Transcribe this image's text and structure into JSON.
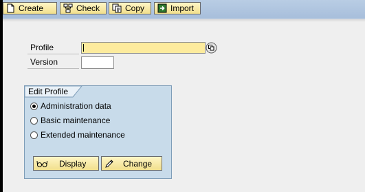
{
  "toolbar": {
    "buttons": [
      {
        "label": "Create",
        "icon": "new-document-icon"
      },
      {
        "label": "Check",
        "icon": "check-hierarchy-icon"
      },
      {
        "label": "Copy",
        "icon": "copy-icon"
      },
      {
        "label": "Import",
        "icon": "import-icon"
      }
    ]
  },
  "form": {
    "profile": {
      "label": "Profile",
      "value": ""
    },
    "version": {
      "label": "Version",
      "value": ""
    }
  },
  "edit_profile": {
    "title": "Edit Profile",
    "options": [
      {
        "label": "Administration data",
        "selected": true
      },
      {
        "label": "Basic maintenance",
        "selected": false
      },
      {
        "label": "Extended maintenance",
        "selected": false
      }
    ],
    "display_label": "Display",
    "change_label": "Change"
  },
  "colors": {
    "toolbar_bg": "#b9cde4",
    "button_bg": "#f5e7a3",
    "required_field": "#fdeb9d",
    "groupbox_bg": "#c8dbea",
    "window_bg": "#efefef"
  }
}
